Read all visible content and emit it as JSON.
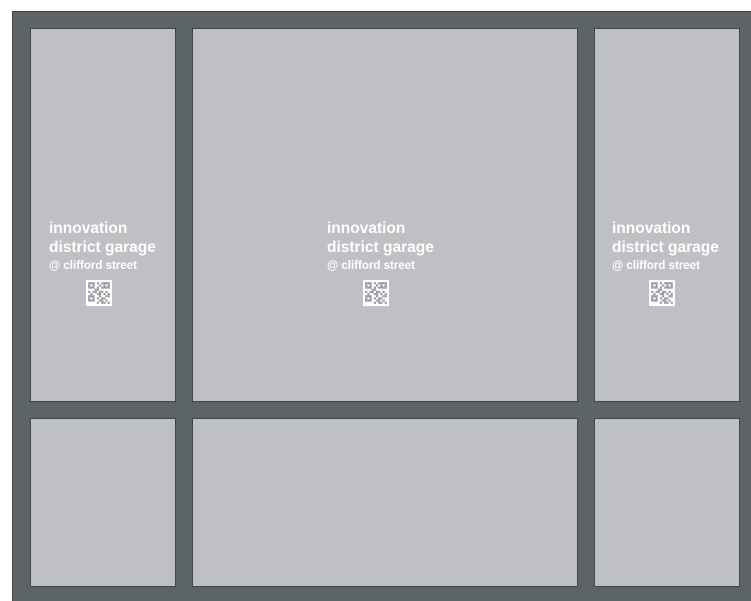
{
  "signs": [
    {
      "title_line1": "innovation",
      "title_line2": "district garage",
      "subtitle": "@ clifford street",
      "code_icon": "qr-code-icon"
    },
    {
      "title_line1": "innovation",
      "title_line2": "district garage",
      "subtitle": "@ clifford street",
      "code_icon": "qr-code-icon"
    },
    {
      "title_line1": "innovation",
      "title_line2": "district garage",
      "subtitle": "@ clifford street",
      "code_icon": "qr-code-icon"
    }
  ],
  "colors": {
    "frame": "#5d6467",
    "panel": "#bfc0c3",
    "text": "#ffffff"
  }
}
